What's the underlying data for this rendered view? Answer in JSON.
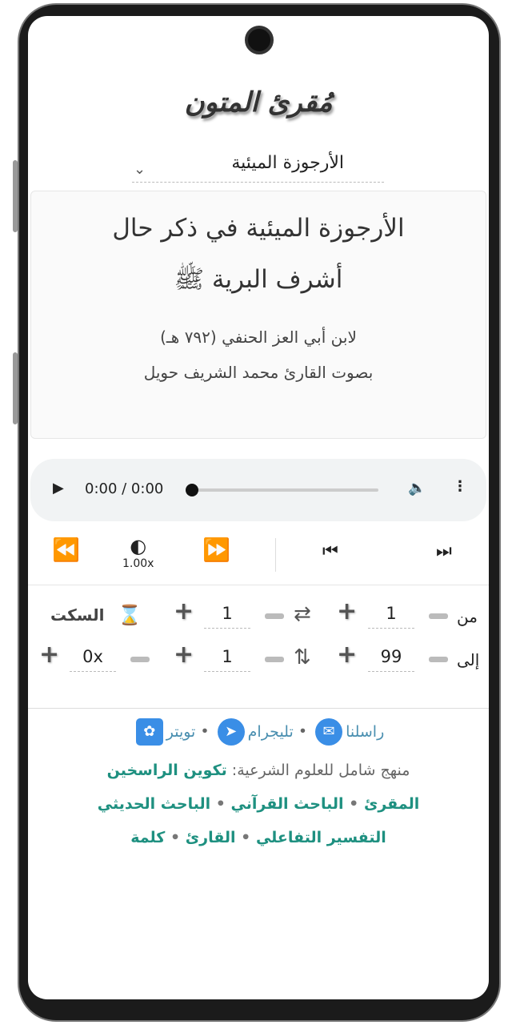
{
  "app": {
    "logo": "مُقرئ المتون"
  },
  "selector": {
    "value": "الأرجوزة الميئية"
  },
  "card": {
    "title": "الأرجوزة الميئية في ذكر حال أشرف البرية ﷺ",
    "author": "لابن أبي العز الحنفي (٧٩٢ هـ)",
    "reciter": "بصوت القارئ محمد الشريف حويل"
  },
  "player": {
    "time": "0:00 / 0:00",
    "progress": 0
  },
  "controls": {
    "speed": "1.00x"
  },
  "settings": {
    "from_label": "من",
    "to_label": "إلى",
    "from_value": "1",
    "to_value": "99",
    "repeat_value": "1",
    "repeat_one_value": "1",
    "silence_label": "السكت",
    "silence_value": "0x"
  },
  "footer": {
    "contact": "راسلنا",
    "telegram": "تليجرام",
    "twitter": "تويتر",
    "sep": "•",
    "curriculum_prefix": "منهج شامل للعلوم الشرعية:",
    "curriculum_link": "تكوين الراسخين",
    "apps": [
      "المقرئ",
      "الباحث القرآني",
      "الباحث الحديثي",
      "التفسير التفاعلي",
      "القارئ",
      "كلمة"
    ]
  }
}
